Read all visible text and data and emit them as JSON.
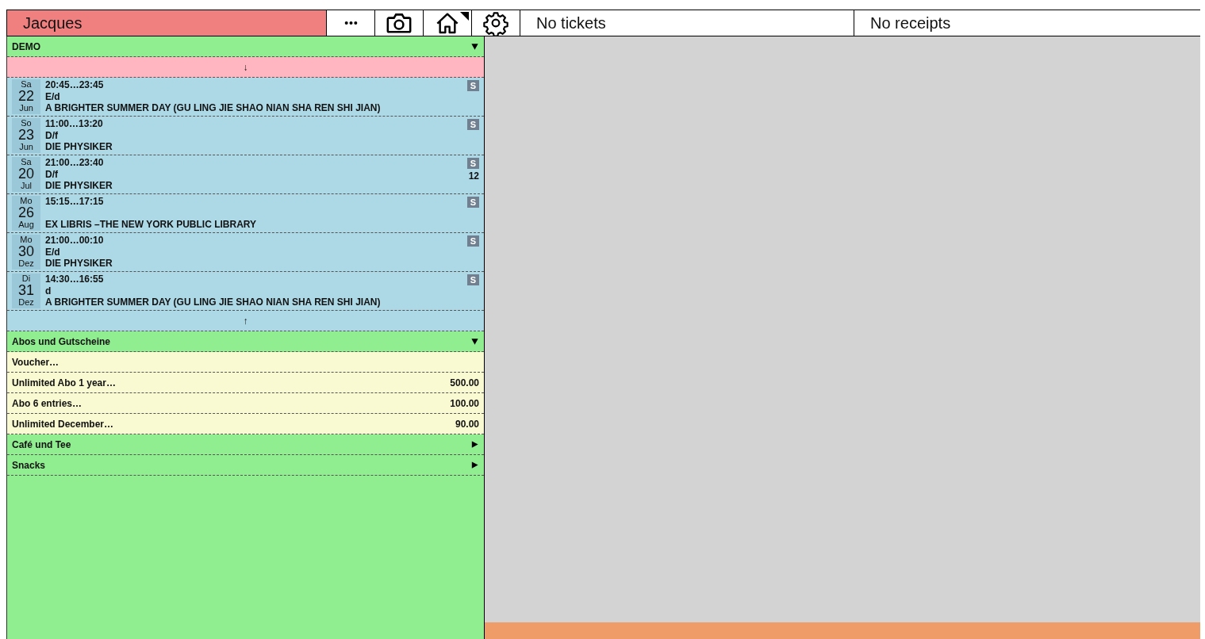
{
  "header": {
    "user": "Jacques",
    "buttons": [
      {
        "kind": "more",
        "corner_mark": false
      },
      {
        "kind": "camera",
        "corner_mark": false
      },
      {
        "kind": "home",
        "corner_mark": true
      },
      {
        "kind": "settings",
        "corner_mark": false
      }
    ],
    "tickets": "No tickets",
    "receipts": "No receipts"
  },
  "sections": [
    {
      "kind": "events",
      "title": "DEMO",
      "expanded": true,
      "scroll_down": "↓",
      "scroll_up": "↑",
      "events": [
        {
          "day_name": "Sa",
          "day": "22",
          "month": "Jun",
          "time": "20:45…23:45",
          "language": "E/d",
          "title": "A BRIGHTER SUMMER DAY (GU LING JIE SHAO NIAN SHA REN SHI JIAN)",
          "badge": "S"
        },
        {
          "day_name": "So",
          "day": "23",
          "month": "Jun",
          "time": "11:00…13:20",
          "language": "D/f",
          "title": "DIE PHYSIKER",
          "badge": "S"
        },
        {
          "day_name": "Sa",
          "day": "20",
          "month": "Jul",
          "time": "21:00…23:40",
          "language": "D/f",
          "title": "DIE PHYSIKER",
          "badge": "S",
          "count": "12"
        },
        {
          "day_name": "Mo",
          "day": "26",
          "month": "Aug",
          "time": "15:15…17:15",
          "title": "EX LIBRIS –THE NEW YORK PUBLIC LIBRARY",
          "badge": "S"
        },
        {
          "day_name": "Mo",
          "day": "30",
          "month": "Dez",
          "time": "21:00…00:10",
          "language": "E/d",
          "title": "DIE PHYSIKER",
          "badge": "S"
        },
        {
          "day_name": "Di",
          "day": "31",
          "month": "Dez",
          "time": "14:30…16:55",
          "language": "d",
          "title": "A BRIGHTER SUMMER DAY (GU LING JIE SHAO NIAN SHA REN SHI JIAN)",
          "badge": "S"
        }
      ]
    },
    {
      "kind": "products",
      "title": "Abos und Gutscheine",
      "expanded": true,
      "items": [
        {
          "name": "Voucher…"
        },
        {
          "name": "Unlimited Abo 1 year…",
          "price": "500.00"
        },
        {
          "name": "Abo 6 entries…",
          "price": "100.00"
        },
        {
          "name": "Unlimited December…",
          "price": "90.00"
        }
      ]
    },
    {
      "title": "Café und Tee",
      "expanded": false
    },
    {
      "title": "Snacks",
      "expanded": false
    }
  ]
}
